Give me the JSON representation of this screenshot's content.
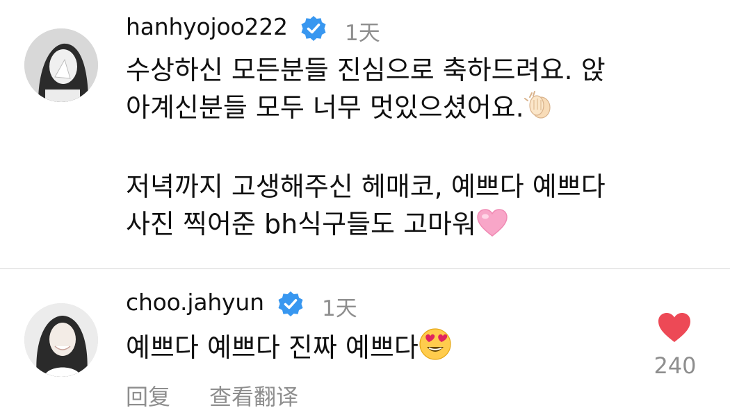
{
  "comments": [
    {
      "username": "hanhyojoo222",
      "time": "1天",
      "verified": true,
      "lines": [
        "수상하신 모든분들 진심으로 축하드려요. 앉",
        "아계신분들 모두 너무 멋있으셨어요.",
        "",
        "저녁까지 고생해주신 헤매코, 예쁘다 예쁘다",
        "사진 찍어준 bh식구들도 고마워"
      ],
      "emojis": [
        "clapping-hands",
        "pink-heart"
      ]
    },
    {
      "username": "choo.jahyun",
      "time": "1天",
      "verified": true,
      "text": "예쁘다 예쁘다 진짜 예쁘다",
      "emoji": "heart-eyes",
      "likes": "240",
      "actions": {
        "reply": "回复",
        "translate": "查看翻译"
      }
    }
  ],
  "colors": {
    "verified_badge": "#3897f0",
    "like_heart": "#ed4956",
    "meta_text": "#8e8e8e"
  }
}
